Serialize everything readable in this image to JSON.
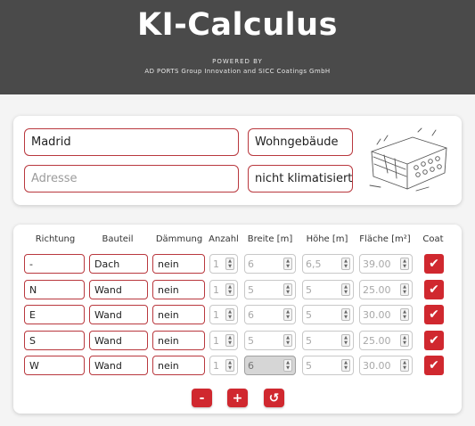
{
  "header": {
    "title": "KI-Calculus",
    "powered_by": "POWERED BY",
    "organizations": "AD PORTS Group Innovation and SICC Coatings GmbH"
  },
  "location": {
    "city": "Madrid",
    "address_placeholder": "Adresse",
    "building_type": "Wohngebäude",
    "climate": "nicht klimatisiert"
  },
  "table": {
    "headers": [
      "Richtung",
      "Bauteil",
      "Dämmung",
      "Anzahl",
      "Breite [m]",
      "Höhe [m]",
      "Fläche [m²]",
      "Coat"
    ],
    "rows": [
      {
        "richtung": "-",
        "bauteil": "Dach",
        "daemmung": "nein",
        "anzahl": "1",
        "breite": "6",
        "hoehe": "6,5",
        "flaeche": "39.00",
        "coat": true
      },
      {
        "richtung": "N",
        "bauteil": "Wand",
        "daemmung": "nein",
        "anzahl": "1",
        "breite": "5",
        "hoehe": "5",
        "flaeche": "25.00",
        "coat": true
      },
      {
        "richtung": "E",
        "bauteil": "Wand",
        "daemmung": "nein",
        "anzahl": "1",
        "breite": "6",
        "hoehe": "5",
        "flaeche": "30.00",
        "coat": true
      },
      {
        "richtung": "S",
        "bauteil": "Wand",
        "daemmung": "nein",
        "anzahl": "1",
        "breite": "5",
        "hoehe": "5",
        "flaeche": "25.00",
        "coat": true
      },
      {
        "richtung": "W",
        "bauteil": "Wand",
        "daemmung": "nein",
        "anzahl": "1",
        "breite": "6",
        "hoehe": "5",
        "flaeche": "30.00",
        "coat": true
      }
    ]
  },
  "actions": {
    "remove_label": "-",
    "add_label": "+",
    "reset_label": "↺"
  },
  "icons": {
    "checkmark": "✔",
    "spin_up": "▲",
    "spin_down": "▼"
  },
  "colors": {
    "header_bg": "#4a4a4a",
    "accent": "#d0282f",
    "field_border": "#b9383e"
  }
}
